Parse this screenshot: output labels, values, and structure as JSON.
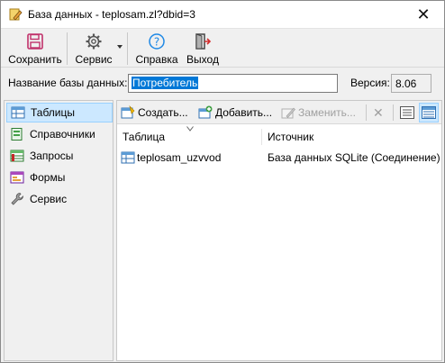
{
  "window": {
    "title": "База данных - teplosam.zl?dbid=3",
    "close_glyph": "✕"
  },
  "toolbar": {
    "save_label": "Сохранить",
    "service_label": "Сервис",
    "help_label": "Справка",
    "exit_label": "Выход"
  },
  "db": {
    "name_label": "Название базы данных:",
    "name_value": "Потребитель",
    "version_label": "Версия:",
    "version_value": "8.06"
  },
  "nav": {
    "items": [
      {
        "label": "Таблицы",
        "icon": "table-icon",
        "selected": true
      },
      {
        "label": "Справочники",
        "icon": "reference-book-icon",
        "selected": false
      },
      {
        "label": "Запросы",
        "icon": "query-icon",
        "selected": false
      },
      {
        "label": "Формы",
        "icon": "form-icon",
        "selected": false
      },
      {
        "label": "Сервис",
        "icon": "wrench-icon",
        "selected": false
      }
    ]
  },
  "subtoolbar": {
    "create_label": "Создать...",
    "add_label": "Добавить...",
    "replace_label": "Заменить...",
    "delete_glyph": "✕"
  },
  "table": {
    "columns": [
      "Таблица",
      "Источник"
    ],
    "rows": [
      {
        "name": "teplosam_uzvvod",
        "source": "База данных SQLite (Соединение)"
      }
    ]
  },
  "colors": {
    "accent": "#0078d7",
    "selection_bg": "#cce8ff",
    "selection_border": "#99d1ff",
    "save_icon": "#c0306a",
    "help_icon": "#1e88e5"
  }
}
